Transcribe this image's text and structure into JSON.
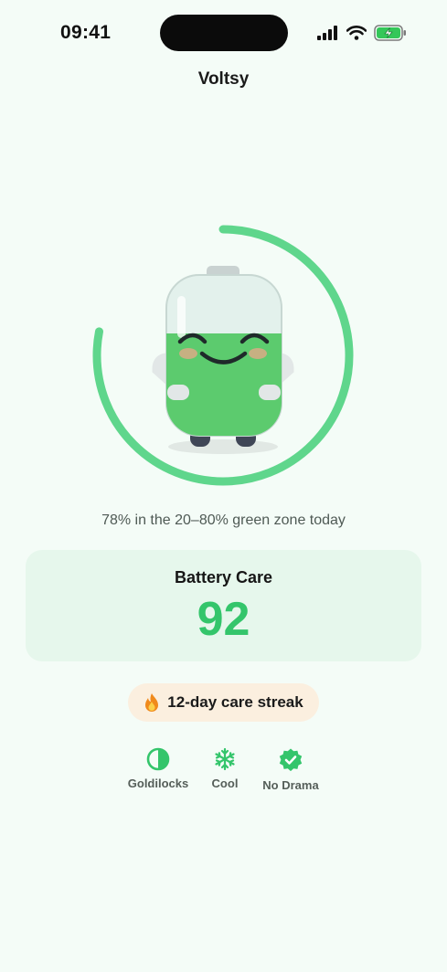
{
  "status_bar": {
    "time": "09:41"
  },
  "app": {
    "title": "Voltsy"
  },
  "ring": {
    "progress_fraction": 0.78,
    "color": "#5fd68c"
  },
  "zone_text": "78% in the 20–80% green zone today",
  "care_card": {
    "label": "Battery Care",
    "score": "92"
  },
  "streak": {
    "icon": "fire-icon",
    "text": "12-day care streak"
  },
  "badges": [
    {
      "label": "Goldilocks",
      "icon": "half-circle-icon"
    },
    {
      "label": "Cool",
      "icon": "snowflake-icon"
    },
    {
      "label": "No Drama",
      "icon": "check-badge-icon"
    }
  ],
  "colors": {
    "accent_green": "#34c56b",
    "background": "#f4fcf7",
    "card_background": "#e6f7ec",
    "streak_background": "#fbefdf"
  }
}
